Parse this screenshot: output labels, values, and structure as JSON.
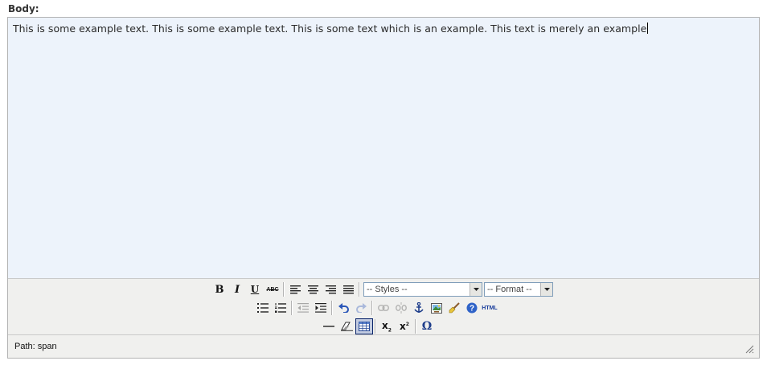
{
  "field": {
    "label": "Body:"
  },
  "editor": {
    "content_text": "This is some example text. This is some example text. This is some text which is an example. This text is merely an example"
  },
  "toolbar": {
    "row1": {
      "bold_glyph": "B",
      "italic_glyph": "I",
      "underline_glyph": "U",
      "strikethrough_glyph": "ABC",
      "styles_select_value": "-- Styles --",
      "format_select_value": "-- Format --"
    },
    "row2": {
      "html_label": "HTML"
    },
    "row3": {
      "subscript_glyph": "x",
      "subscript_suffix": "2",
      "superscript_glyph": "x",
      "superscript_suffix": "2",
      "charmap_glyph": "Ω"
    }
  },
  "status": {
    "path_text": "Path: span"
  },
  "colors": {
    "accent": "#0a246a",
    "editor_bg": "#edf3fb",
    "toolbar_bg": "#f0f0ee"
  },
  "icons": [
    "align-left-icon",
    "align-center-icon",
    "align-right-icon",
    "align-justify-icon",
    "bullet-list-icon",
    "numbered-list-icon",
    "outdent-icon",
    "indent-icon",
    "undo-icon",
    "redo-icon",
    "link-icon",
    "unlink-icon",
    "anchor-icon",
    "image-icon",
    "cleanup-icon",
    "help-icon",
    "horizontal-rule-icon",
    "remove-format-icon",
    "table-icon",
    "resize-grip-icon"
  ]
}
